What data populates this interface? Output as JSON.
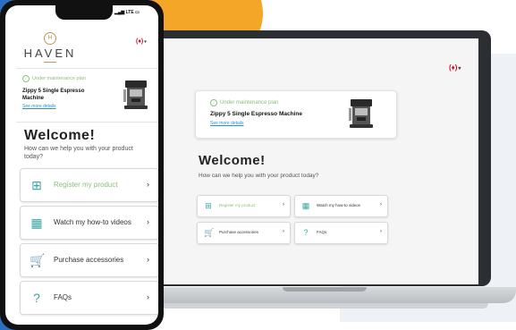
{
  "colors": {
    "accent_teal": "#38a6a0",
    "plan_green": "#8bbf7a",
    "link_blue": "#2a8fd0",
    "brand_gold": "#b79a5a",
    "bg_orange": "#f4a629",
    "bg_blue": "#2c6fc1"
  },
  "phone": {
    "status": "LTE",
    "brand": "HAVEN",
    "brand_mark": "H",
    "language_flag": "(♦)",
    "plan": {
      "status_text": "Under maintenance plan",
      "product_name": "Zippy 5 Single Espresso Machine",
      "details_link": "See more details"
    },
    "welcome_title": "Welcome!",
    "welcome_subtitle": "How can we help you with your product today?",
    "actions": [
      {
        "label": "Register my product",
        "icon": "plus-square-icon",
        "glyph": "⊞"
      },
      {
        "label": "Watch my how-to videos",
        "icon": "film-icon",
        "glyph": "▦"
      },
      {
        "label": "Purchase accessories",
        "icon": "cart-icon",
        "glyph": "🛒"
      },
      {
        "label": "FAQs",
        "icon": "question-icon",
        "glyph": "?"
      }
    ]
  },
  "desktop": {
    "language_flag": "(♦)",
    "plan": {
      "status_text": "Under maintenance plan",
      "product_name": "Zippy 5 Single Espresso Machine",
      "details_link": "See more details"
    },
    "welcome_title": "Welcome!",
    "welcome_subtitle": "How can we help you with your product today?",
    "actions": [
      {
        "label": "Register my product",
        "icon": "plus-square-icon",
        "glyph": "⊞"
      },
      {
        "label": "Watch my how-to videos",
        "icon": "film-icon",
        "glyph": "▦"
      },
      {
        "label": "Purchase accessories",
        "icon": "cart-icon",
        "glyph": "🛒"
      },
      {
        "label": "FAQs",
        "icon": "question-icon",
        "glyph": "?"
      }
    ]
  },
  "glyphs": {
    "chevron": "›",
    "caret": "▾",
    "check": "✓"
  }
}
